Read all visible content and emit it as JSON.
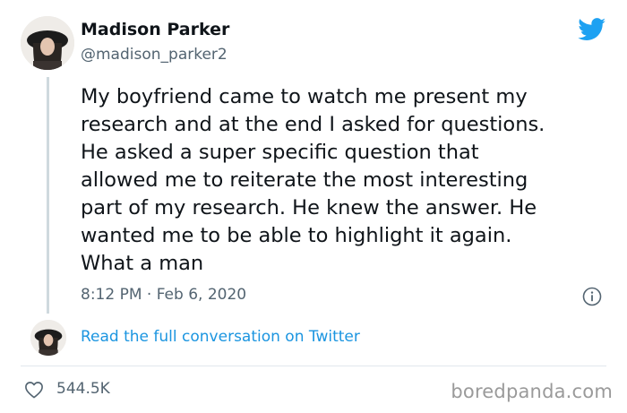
{
  "tweet": {
    "author": {
      "display_name": "Madison Parker",
      "handle": "@madison_parker2",
      "avatar_icon": "profile-photo-avatar"
    },
    "text": "My boyfriend came to watch me present my\nresearch and at the end I asked for questions.\nHe asked a super specific question that\nallowed me to reiterate the most interesting\npart of my research. He knew the answer. He\nwanted me to be able to highlight it again.\nWhat a man",
    "timestamp": "8:12 PM · Feb 6, 2020",
    "conversation_link": "Read the full conversation on Twitter",
    "likes": "544.5K"
  },
  "icons": {
    "brand": "twitter-bird-icon",
    "info": "info-icon",
    "like": "heart-icon"
  },
  "watermark": "boredpanda.com",
  "colors": {
    "twitter_blue": "#1da1f2",
    "link_blue": "#1b95e0",
    "secondary_text": "#536471",
    "primary_text": "#0f1419",
    "divider": "#e1e8ed"
  }
}
